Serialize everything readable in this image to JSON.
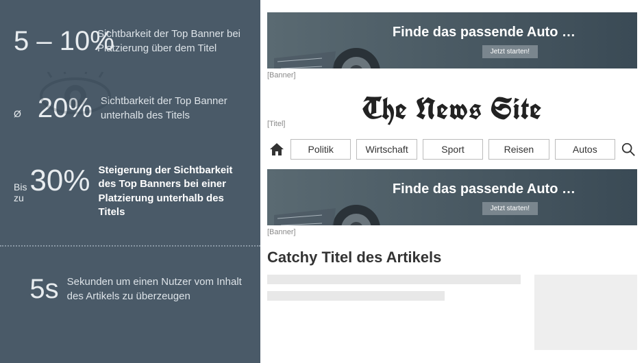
{
  "stats": {
    "row1": {
      "value": "5 – 10%",
      "desc": "Sichtbarkeit der Top Banner bei Platzierung über dem Titel"
    },
    "row2": {
      "prefix": "Ø",
      "value": "20%",
      "desc": "Sichtbarkeit  der Top Banner unterhalb des Titels"
    },
    "row3": {
      "prefix": "Bis zu",
      "value": "30%",
      "desc": "Steigerung der Sicht­barkeit des Top Banners bei einer Platzierung unterhalb des Titels"
    },
    "row4": {
      "value": "5s",
      "desc": "Sekunden um einen Nutzer vom Inhalt des Artikels zu überzeugen"
    }
  },
  "labels": {
    "banner": "[Banner]",
    "titel": "[Titel]"
  },
  "banner": {
    "headline": "Finde das passende Auto …",
    "cta": "Jetzt starten!"
  },
  "site": {
    "title": "The News Site"
  },
  "nav": {
    "items": [
      "Politik",
      "Wirtschaft",
      "Sport",
      "Reisen",
      "Autos"
    ]
  },
  "article": {
    "title": "Catchy Titel des Artikels"
  }
}
